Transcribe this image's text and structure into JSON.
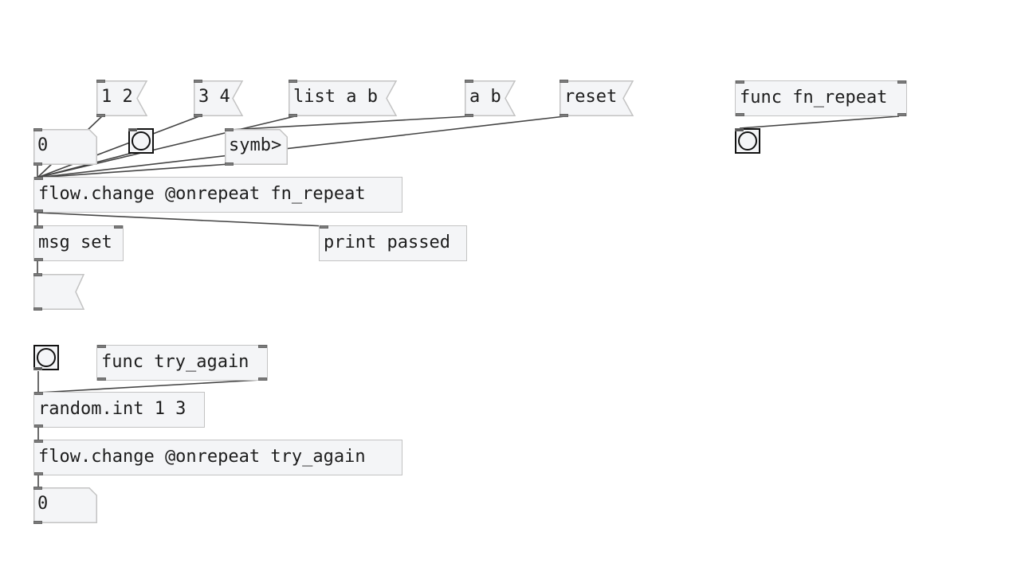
{
  "patch": {
    "messages": {
      "m12": "1 2",
      "m34": "3 4",
      "list_ab": "list a b",
      "ab": "a b",
      "reset": "reset",
      "func_fn_repeat": "func fn_repeat",
      "func_try_again": "func try_again",
      "empty_msg": ""
    },
    "numbers": {
      "num_top": "0",
      "num_bottom": "0"
    },
    "objects": {
      "symb": "symb>",
      "flow_change_1": "flow.change @onrepeat fn_repeat",
      "msg_set": "msg set",
      "print_passed": "print passed",
      "random_int": "random.int 1 3",
      "flow_change_2": "flow.change @onrepeat try_again"
    }
  }
}
